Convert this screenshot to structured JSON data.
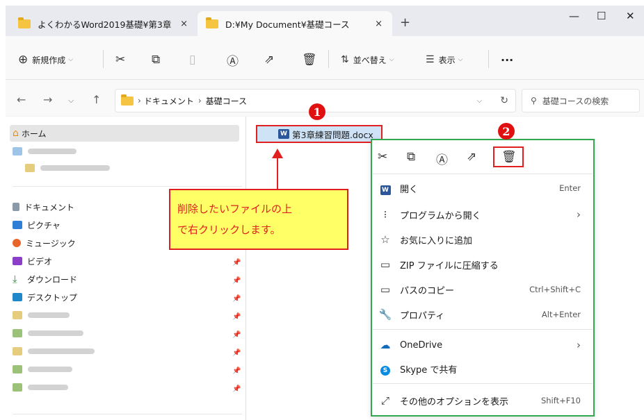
{
  "tabs": [
    {
      "label": "よくわかるWord2019基礎¥第3章",
      "close": "×"
    },
    {
      "label": "D:¥My Document¥基礎コース",
      "close": "×"
    }
  ],
  "new_tab": "+",
  "window_controls": {
    "minimize": "—",
    "maximize": "☐",
    "close": "✕"
  },
  "toolbar": {
    "new_label": "新規作成",
    "sort_label": "並べ替え",
    "view_label": "表示",
    "more": "···"
  },
  "address": {
    "path": [
      "ドキュメント",
      "基礎コース"
    ],
    "search_placeholder": "基礎コースの検索"
  },
  "nav": {
    "home": "ホーム",
    "items": [
      "ドキュメント",
      "ピクチャ",
      "ミュージック",
      "ビデオ",
      "ダウンロード",
      "デスクトップ"
    ]
  },
  "file": {
    "name": "第3章練習問題.docx",
    "icon_letter": "W"
  },
  "badges": {
    "one": "1",
    "two": "2"
  },
  "callout": {
    "line1": "削除したいファイルの上",
    "line2": "で右クリックします。"
  },
  "menu": [
    {
      "label": "開く",
      "shortcut": "Enter"
    },
    {
      "label": "プログラムから開く",
      "shortcut": "›"
    },
    {
      "label": "お気に入りに追加",
      "shortcut": ""
    },
    {
      "label": "ZIP ファイルに圧縮する",
      "shortcut": ""
    },
    {
      "label": "パスのコピー",
      "shortcut": "Ctrl+Shift+C"
    },
    {
      "label": "プロパティ",
      "shortcut": "Alt+Enter"
    },
    {
      "label": "OneDrive",
      "shortcut": "›"
    },
    {
      "label": "Skype で共有",
      "shortcut": ""
    },
    {
      "label": "その他のオプションを表示",
      "shortcut": "Shift+F10"
    }
  ],
  "colors": {
    "annotation_red": "#e02020",
    "menu_border_green": "#2fa84f",
    "callout_fill": "#ffff66"
  }
}
